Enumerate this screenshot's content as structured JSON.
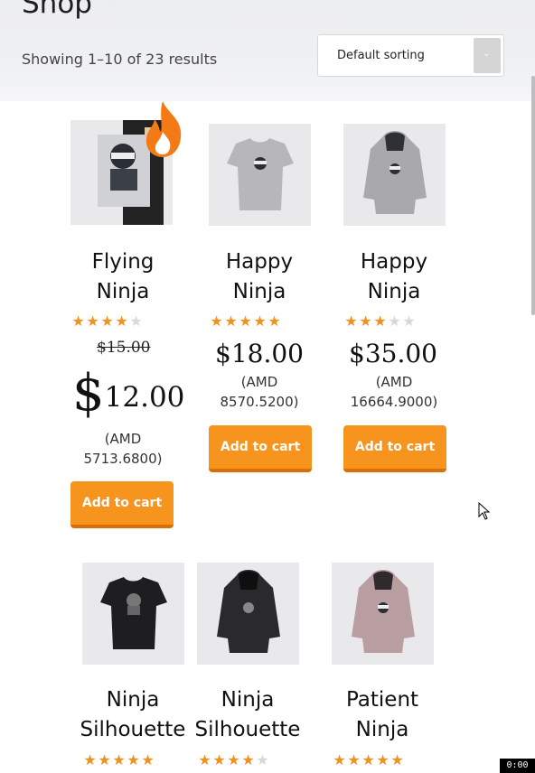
{
  "page": {
    "title": "Shop",
    "result_count": "Showing 1–10 of 23 results"
  },
  "sorting": {
    "selected": "Default sorting",
    "arrow_icon": "chevron-down-icon"
  },
  "colors": {
    "accent": "#f7941d",
    "accent_dark": "#d96f05",
    "star_on": "#f0921e",
    "star_off": "#d8d8d8",
    "header_bg": "#eeeff1"
  },
  "products": [
    {
      "name_line1": "Flying",
      "name_line2": "Ninja",
      "rating": 4,
      "regular_price": "$15.00",
      "sale_currency": "$",
      "sale_amount": "12.00",
      "converted_line1": "(AMD",
      "converted_line2": "5713.6800)",
      "button": "Add to cart",
      "image": "poster-ninja",
      "hot_badge_icon": "flame-icon"
    },
    {
      "name_line1": "Happy",
      "name_line2": "Ninja",
      "rating": 5,
      "price": "$18.00",
      "converted_line1": "(AMD",
      "converted_line2": "8570.5200)",
      "button": "Add to cart",
      "image": "grey-tshirt"
    },
    {
      "name_line1": "Happy",
      "name_line2": "Ninja",
      "rating": 3,
      "price": "$35.00",
      "converted_line1": "(AMD",
      "converted_line2": "16664.9000)",
      "button": "Add to cart",
      "image": "grey-hoodie"
    },
    {
      "name_line1": "Ninja",
      "name_line2": "Silhouette",
      "rating": 5,
      "image": "black-tshirt"
    },
    {
      "name_line1": "Ninja",
      "name_line2": "Silhouette",
      "rating": 4,
      "image": "black-hoodie"
    },
    {
      "name_line1": "Patient",
      "name_line2": "Ninja",
      "rating": 4.5,
      "image": "pink-hoodie"
    }
  ],
  "recording_timer": "0:00"
}
